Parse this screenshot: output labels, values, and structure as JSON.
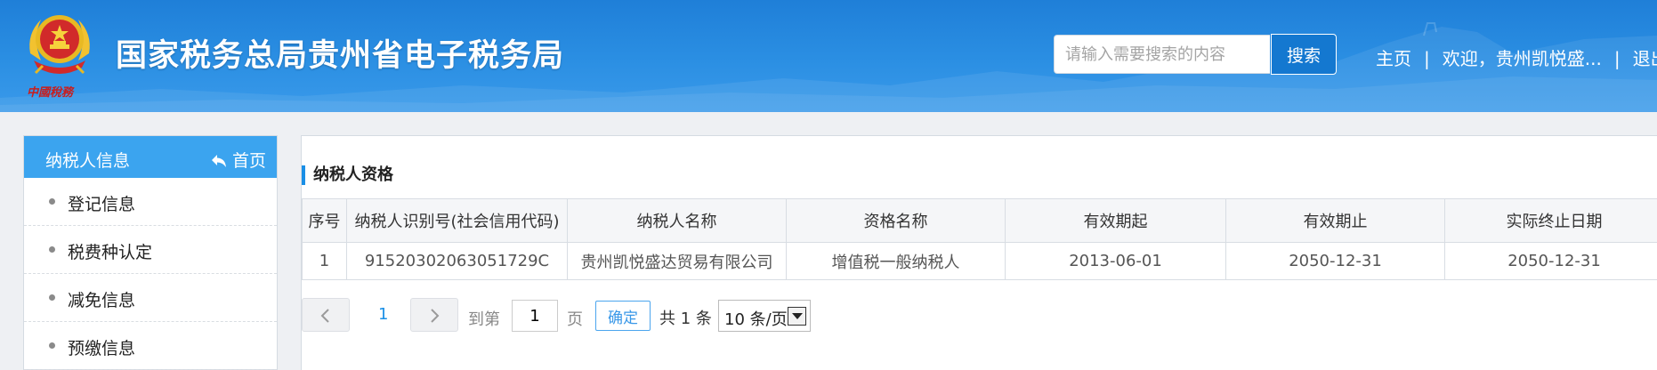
{
  "header": {
    "site_title": "国家税务总局贵州省电子税务局",
    "emblem_caption": "中國稅務",
    "search_placeholder": "请输入需要搜索的内容",
    "search_button": "搜索",
    "nav_home": "主页",
    "nav_separator": "|",
    "nav_welcome": "欢迎，贵州凯悦盛...",
    "nav_logout": "退出",
    "colors": {
      "bar": "#2b8fe3",
      "button": "#1478d0"
    }
  },
  "sidebar": {
    "title": "纳税人信息",
    "home_link": "首页",
    "home_icon": "reply-arrow-icon",
    "items": [
      {
        "label": "登记信息"
      },
      {
        "label": "税费种认定"
      },
      {
        "label": "减免信息"
      },
      {
        "label": "预缴信息"
      }
    ]
  },
  "main": {
    "section_title": "纳税人资格",
    "table": {
      "columns": [
        "序号",
        "纳税人识别号(社会信用代码)",
        "纳税人名称",
        "资格名称",
        "有效期起",
        "有效期止",
        "实际终止日期"
      ],
      "rows": [
        [
          "1",
          "91520302063051729C",
          "贵州凯悦盛达贸易有限公司",
          "增值税一般纳税人",
          "2013-06-01",
          "2050-12-31",
          "2050-12-31"
        ]
      ]
    },
    "pagination": {
      "current_page": "1",
      "goto_label": "到第",
      "goto_value": "1",
      "page_suffix": "页",
      "confirm": "确定",
      "total": "共 1 条",
      "page_size": "10 条/页"
    }
  }
}
